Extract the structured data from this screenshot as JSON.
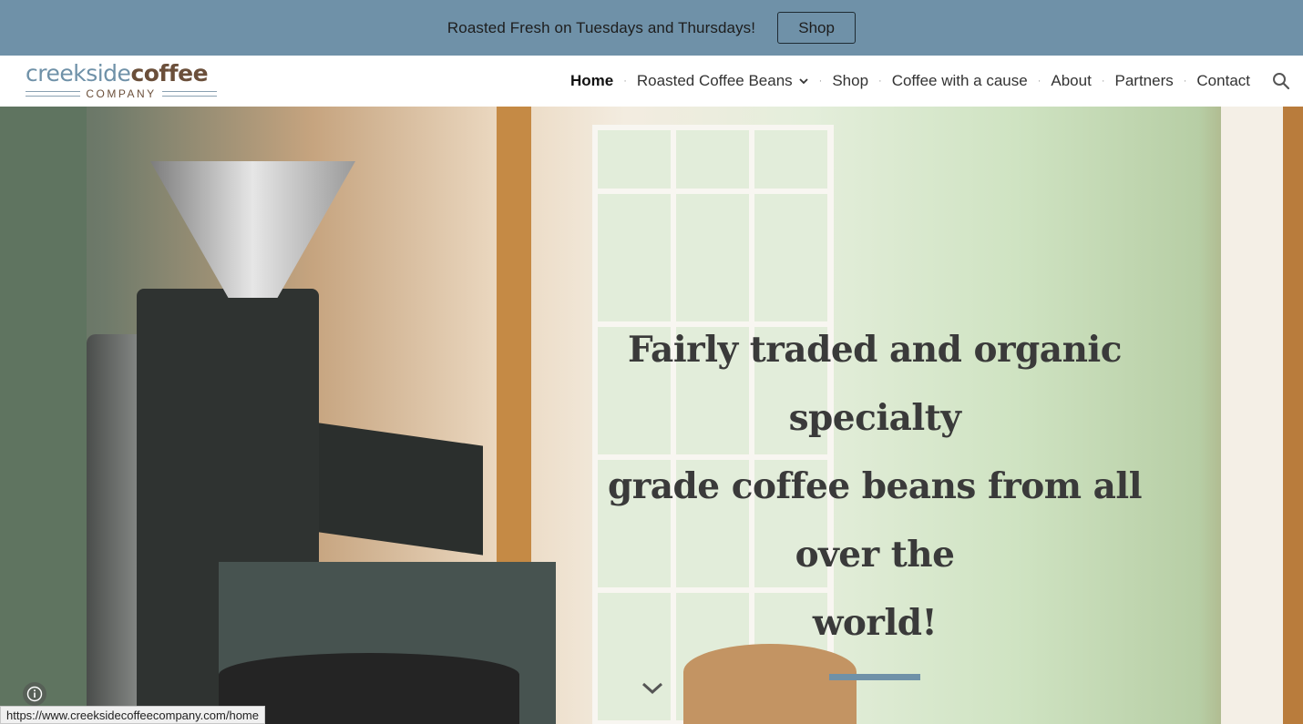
{
  "banner": {
    "text": "Roasted Fresh on Tuesdays and Thursdays!",
    "button_label": "Shop"
  },
  "logo": {
    "part1": "creekside",
    "part2": "coffee",
    "subtitle": "COMPANY"
  },
  "nav": {
    "items": [
      {
        "label": "Home",
        "active": true
      },
      {
        "label": "Roasted Coffee Beans",
        "has_dropdown": true
      },
      {
        "label": "Shop"
      },
      {
        "label": "Coffee with a cause"
      },
      {
        "label": "About"
      },
      {
        "label": "Partners"
      },
      {
        "label": "Contact"
      }
    ],
    "separator": "·",
    "search_icon": "search-icon"
  },
  "hero": {
    "headline_line1": "Fairly traded and organic specialty",
    "headline_line2": "grade coffee beans from all over the",
    "headline_line3": "world!",
    "accent_color": "#6f91a8",
    "scroll_icon": "chevron-down-icon"
  },
  "status_bar": {
    "url": "https://www.creeksidecoffeecompany.com/home"
  },
  "colors": {
    "banner_bg": "#6f91a8",
    "logo_blue": "#6f91a8",
    "logo_brown": "#6b4f3a"
  }
}
